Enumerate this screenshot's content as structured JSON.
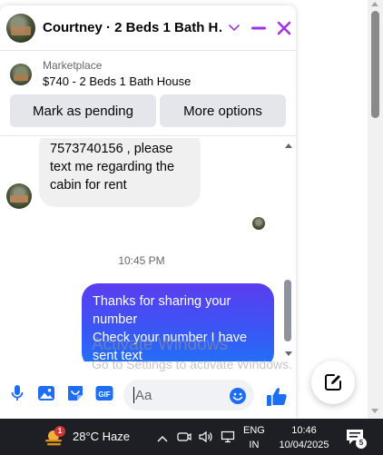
{
  "header": {
    "title": "Courtney · 2 Beds 1 Bath H…",
    "accent_color": "#a033e6"
  },
  "listing": {
    "source": "Marketplace",
    "name": "$740 - 2 Beds 1 Bath House"
  },
  "actions": {
    "mark_pending": "Mark as pending",
    "more_options": "More options"
  },
  "messages": {
    "received": {
      "lines": [
        "7573740156 , please",
        "text me regarding the",
        "cabin for rent"
      ]
    },
    "timestamp": "10:45 PM",
    "sent": {
      "lines": [
        "Thanks for sharing your",
        "number",
        "Check your number I have",
        "sent text"
      ]
    }
  },
  "composer": {
    "placeholder": "Aa"
  },
  "watermark": {
    "title": "Activate Windows",
    "subtitle": "Go to Settings to activate Windows."
  },
  "taskbar": {
    "weather_badge": "1",
    "weather": "28°C  Haze",
    "language_line1": "ENG",
    "language_line2": "IN",
    "time": "10:46",
    "date": "10/04/2025",
    "notification_count": "5"
  }
}
